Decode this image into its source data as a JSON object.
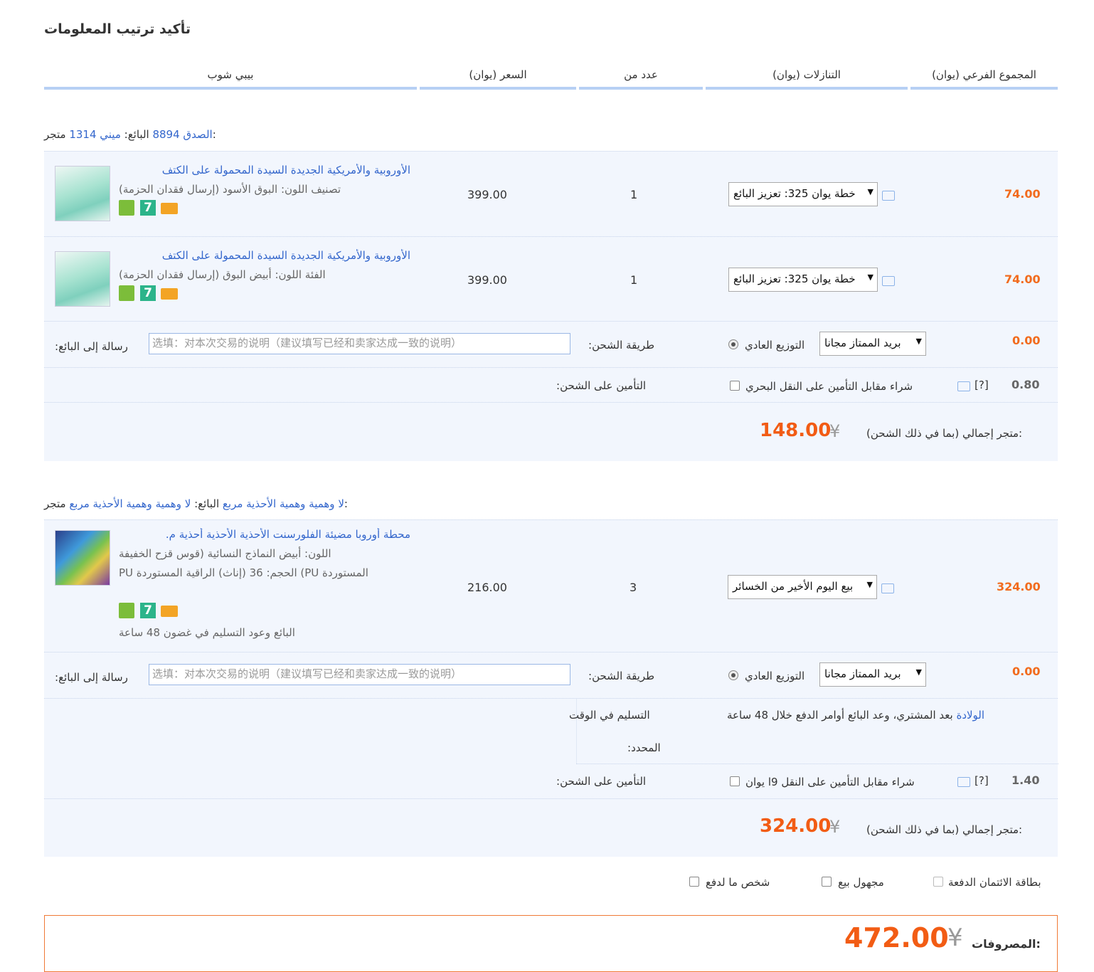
{
  "page": {
    "title": "تأكيد ترتيب المعلومات"
  },
  "columns": {
    "product": "بيبي شوب",
    "price": "(السعر (يوان",
    "qty": "عدد من",
    "discount": "(التنازلات (يوان",
    "subtotal": "(المجموع الفرعي (يوان"
  },
  "shops": [
    {
      "shop_label": "متجر:",
      "shop_name": "ميني 1314",
      "seller_label": "البائع:",
      "seller_name": "الصدق 8894",
      "items": [
        {
          "name": "الأوروبية والأمريكية الجديدة السيدة المحمولة على الكتف",
          "sku": "(تصنيف اللون: البوق الأسود (إرسال فقدان الحزمة",
          "price": "399.00",
          "qty": "1",
          "discount": "خطة يوان 325: تعزيز البائع",
          "subtotal": "74.00"
        },
        {
          "name": "الأوروبية والأمريكية الجديدة السيدة المحمولة على الكتف",
          "sku": "(الفئة اللون: أبيض البوق (إرسال فقدان الحزمة",
          "price": "399.00",
          "qty": "1",
          "discount": "خطة يوان 325: تعزيز البائع",
          "subtotal": "74.00"
        }
      ],
      "message_label": ":رسالة إلى البائع",
      "message_placeholder": "选填：对本次交易的说明（建议填写已经和卖家达成一致的说明）",
      "shipping_label": ":طريقة الشحن",
      "shipping_option": "التوزيع العادي",
      "shipping_select": "بريد الممتاز مجانا",
      "shipping_cost": "0.00",
      "insurance_label": ":التأمين على الشحن",
      "insurance_text": "شراء مقابل التأمين على النقل البحري",
      "insurance_help": "[?]",
      "insurance_cost": "0.80",
      "total_label": "متجر إجمالي (بما في ذلك الشحن):",
      "total_currency": "¥",
      "total_value": "148.00"
    },
    {
      "shop_label": "متجر:",
      "shop_name": "لا وهمية وهمية الأحذية مربع",
      "seller_label": "البائع:",
      "seller_name": "لا وهمية وهمية الأحذية مربع",
      "items": [
        {
          "name": ".محطة أوروبا مضيئة الفلورسنت الأحذية الأحذية أحذية م",
          "sku1": "اللون: أبيض النماذج النسائية (قوس قزح الخفيفة",
          "sku2": "PU الحجم: 36 (إناث) الراقية المستوردة   (PU المستوردة",
          "promise": "البائع وعود التسليم في غضون 48 ساعة",
          "price": "216.00",
          "qty": "3",
          "discount": "بيع اليوم الأخير من الخسائر",
          "subtotal": "324.00"
        }
      ],
      "message_label": ":رسالة إلى البائع",
      "message_placeholder": "选填：对本次交易的说明（建议填写已经和卖家达成一致的说明）",
      "shipping_label": ":طريقة الشحن",
      "shipping_option": "التوزيع العادي",
      "shipping_select": "بريد الممتاز مجانا",
      "shipping_cost": "0.00",
      "ontime_label_1": "التسليم في الوقت",
      "ontime_label_2": ":المحدد",
      "ontime_text": "بعد المشتري، وعد البائع أوامر الدفع خلال 48 ساعة",
      "ontime_link": "الولادة",
      "insurance_label": ":التأمين على الشحن",
      "insurance_text": "شراء مقابل التأمين على النقل 9ا يوان",
      "insurance_help": "[?]",
      "insurance_cost": "1.40",
      "total_label": "متجر إجمالي (بما في ذلك الشحن):",
      "total_currency": "¥",
      "total_value": "324.00"
    }
  ],
  "options": {
    "credit_card": "بطاقة الائتمان الدفعة",
    "anonymous": "مجهول بيع",
    "pay_for_someone": "شخص ما لدفع"
  },
  "payment": {
    "label": "المصروفات:",
    "currency": "¥",
    "value": "472.00"
  },
  "colors": {
    "accent": "#f25c14",
    "link": "#3366cc",
    "header_rule": "#b7d0f4",
    "row_bg": "#f2f6fd"
  },
  "icons": [
    "chat-icon",
    "help-icon",
    "shield-badge-icon",
    "seven-day-badge-icon",
    "card-badge-icon",
    "dropdown-arrow-icon"
  ]
}
